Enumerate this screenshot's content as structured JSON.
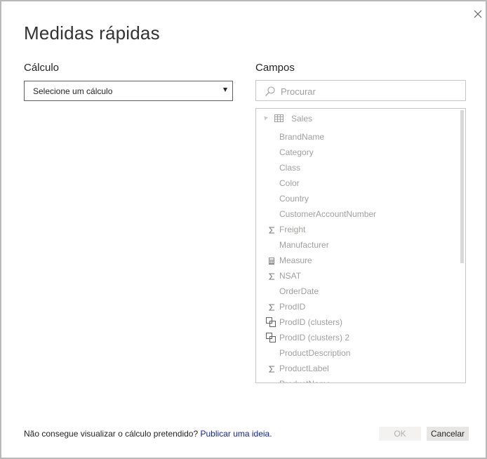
{
  "dialog": {
    "title": "Medidas rápidas",
    "close_icon": "close-icon"
  },
  "calculation": {
    "label": "Cálculo",
    "select_value": "Selecione um cálculo"
  },
  "fields": {
    "label": "Campos",
    "search_placeholder": "Procurar",
    "table": {
      "name": "Sales",
      "icon": "table-icon"
    },
    "items": [
      {
        "name": "BrandName",
        "icon": ""
      },
      {
        "name": "Category",
        "icon": ""
      },
      {
        "name": "Class",
        "icon": ""
      },
      {
        "name": "Color",
        "icon": ""
      },
      {
        "name": "Country",
        "icon": ""
      },
      {
        "name": "CustomerAccountNumber",
        "icon": ""
      },
      {
        "name": "Freight",
        "icon": "sigma-icon"
      },
      {
        "name": "Manufacturer",
        "icon": ""
      },
      {
        "name": "Measure",
        "icon": "calculator-icon"
      },
      {
        "name": "NSAT",
        "icon": "sigma-icon"
      },
      {
        "name": "OrderDate",
        "icon": ""
      },
      {
        "name": "ProdID",
        "icon": "sigma-icon"
      },
      {
        "name": "ProdID (clusters)",
        "icon": "group-icon"
      },
      {
        "name": "ProdID (clusters) 2",
        "icon": "group-icon"
      },
      {
        "name": "ProductDescription",
        "icon": ""
      },
      {
        "name": "ProductLabel",
        "icon": "sigma-icon"
      },
      {
        "name": "ProductName",
        "icon": ""
      }
    ]
  },
  "footer": {
    "prompt_text": "Não consegue visualizar o cálculo pretendido?",
    "link_text": "Publicar uma ideia."
  },
  "buttons": {
    "ok_label": "OK",
    "cancel_label": "Cancelar"
  },
  "colors": {
    "link": "#0f1fa0",
    "field_text": "#a19f9d",
    "border": "#c8c6c4"
  }
}
